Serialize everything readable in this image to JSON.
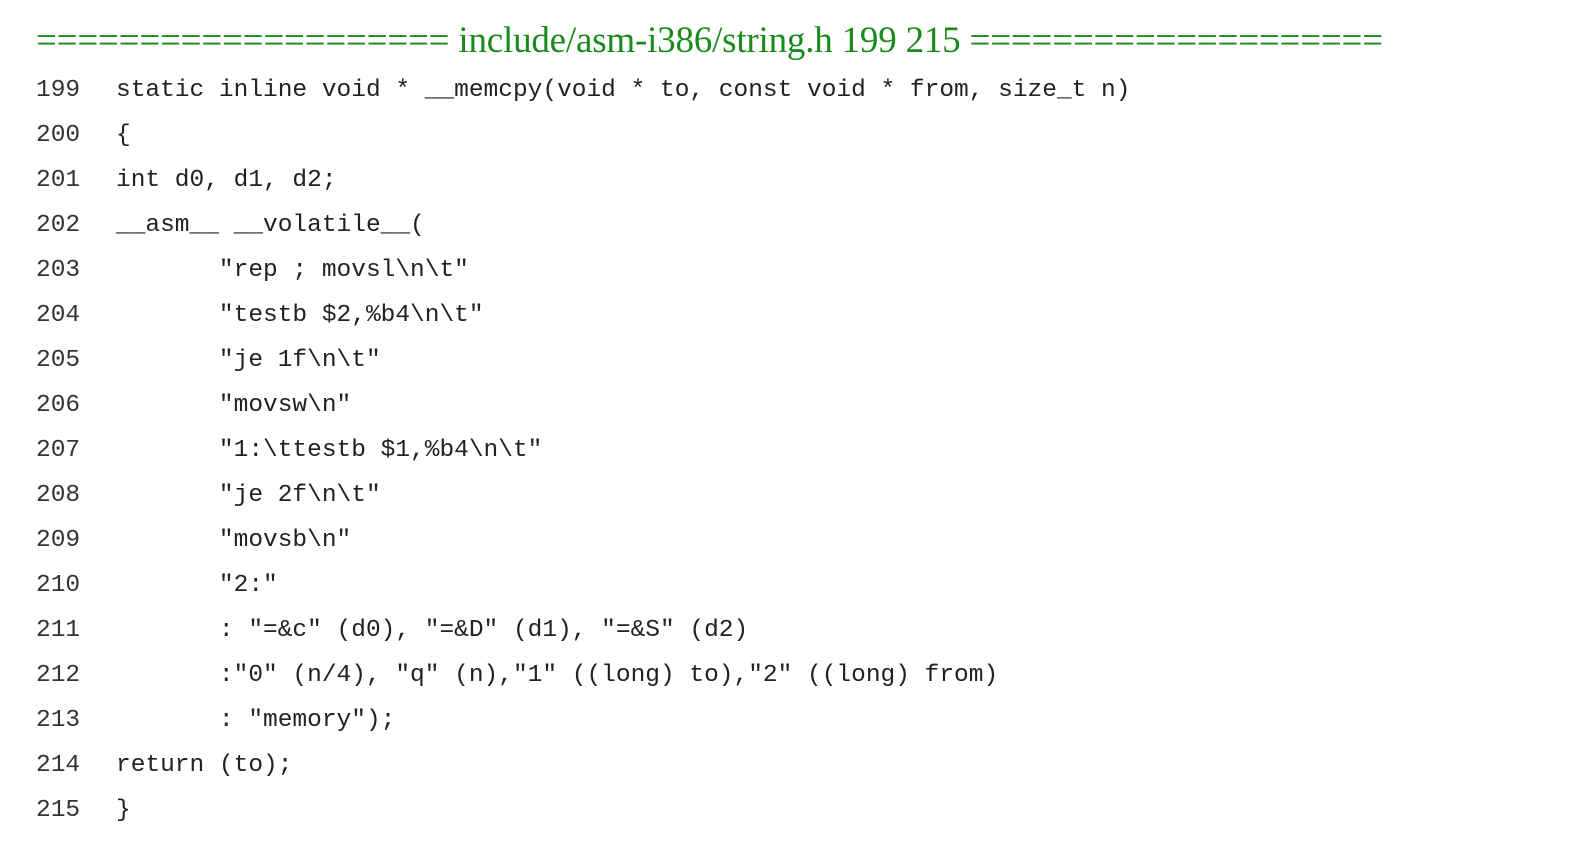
{
  "header": {
    "title": "==================== include/asm-i386/string.h 199 215 ===================="
  },
  "code": {
    "lines": [
      {
        "number": "199",
        "text": "static inline void * __memcpy(void * to, const void * from, size_t n)"
      },
      {
        "number": "200",
        "text": "{"
      },
      {
        "number": "201",
        "text": "int d0, d1, d2;"
      },
      {
        "number": "202",
        "text": "__asm__ __volatile__("
      },
      {
        "number": "203",
        "text": "       \"rep ; movsl\\n\\t\""
      },
      {
        "number": "204",
        "text": "       \"testb $2,%b4\\n\\t\""
      },
      {
        "number": "205",
        "text": "       \"je 1f\\n\\t\""
      },
      {
        "number": "206",
        "text": "       \"movsw\\n\""
      },
      {
        "number": "207",
        "text": "       \"1:\\ttestb $1,%b4\\n\\t\""
      },
      {
        "number": "208",
        "text": "       \"je 2f\\n\\t\""
      },
      {
        "number": "209",
        "text": "       \"movsb\\n\""
      },
      {
        "number": "210",
        "text": "       \"2:\""
      },
      {
        "number": "211",
        "text": "       : \"=&c\" (d0), \"=&D\" (d1), \"=&S\" (d2)"
      },
      {
        "number": "212",
        "text": "       :\"0\" (n/4), \"q\" (n),\"1\" ((long) to),\"2\" ((long) from)"
      },
      {
        "number": "213",
        "text": "       : \"memory\");"
      },
      {
        "number": "214",
        "text": "return (to);"
      },
      {
        "number": "215",
        "text": "}"
      }
    ]
  },
  "colors": {
    "header_text": "#1a8a1a",
    "code_text": "#222222",
    "background": "#ffffff"
  }
}
